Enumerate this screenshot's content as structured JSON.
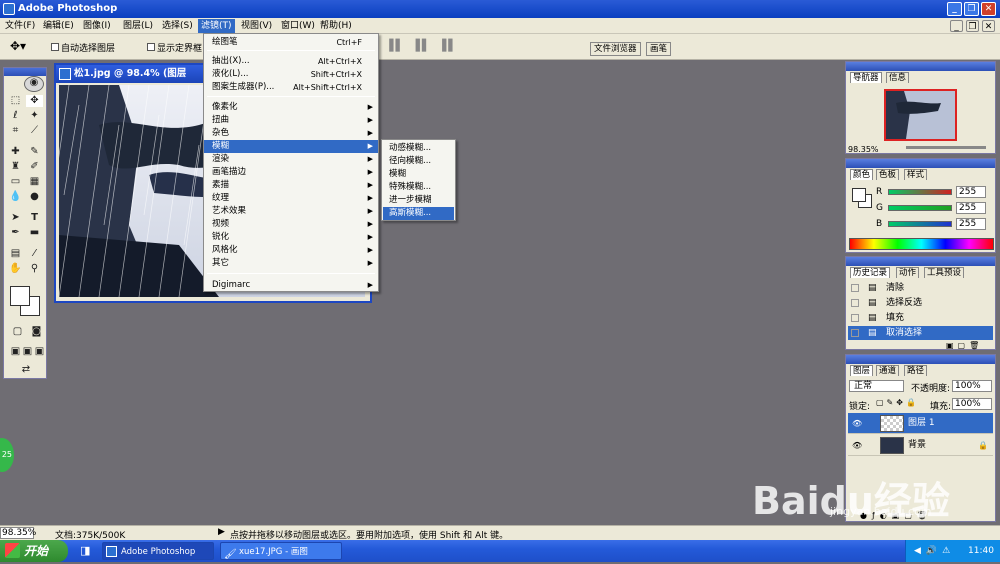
{
  "window": {
    "title": "Adobe Photoshop"
  },
  "menubar": {
    "items": [
      "文件(F)",
      "编辑(E)",
      "图像(I)",
      "图层(L)",
      "选择(S)",
      "滤镜(T)",
      "视图(V)",
      "窗口(W)",
      "帮助(H)"
    ],
    "active_index": 5
  },
  "options": {
    "auto_select": "自动选择图层",
    "show_bounds": "显示定界框",
    "right_tabs": [
      "文件浏览器",
      "画笔"
    ]
  },
  "document": {
    "title": "松1.jpg @ 98.4% (图层"
  },
  "filter_menu": {
    "items": [
      {
        "label": "绘图笔",
        "shortcut": "Ctrl+F",
        "sub": false
      },
      {
        "label": "抽出(X)...",
        "shortcut": "Alt+Ctrl+X",
        "sub": false
      },
      {
        "label": "液化(L)...",
        "shortcut": "Shift+Ctrl+X",
        "sub": false
      },
      {
        "label": "图案生成器(P)...",
        "shortcut": "Alt+Shift+Ctrl+X",
        "sub": false
      },
      {
        "label": "像素化",
        "shortcut": "",
        "sub": true
      },
      {
        "label": "扭曲",
        "shortcut": "",
        "sub": true
      },
      {
        "label": "杂色",
        "shortcut": "",
        "sub": true
      },
      {
        "label": "模糊",
        "shortcut": "",
        "sub": true
      },
      {
        "label": "渲染",
        "shortcut": "",
        "sub": true
      },
      {
        "label": "画笔描边",
        "shortcut": "",
        "sub": true
      },
      {
        "label": "素描",
        "shortcut": "",
        "sub": true
      },
      {
        "label": "纹理",
        "shortcut": "",
        "sub": true
      },
      {
        "label": "艺术效果",
        "shortcut": "",
        "sub": true
      },
      {
        "label": "视频",
        "shortcut": "",
        "sub": true
      },
      {
        "label": "锐化",
        "shortcut": "",
        "sub": true
      },
      {
        "label": "风格化",
        "shortcut": "",
        "sub": true
      },
      {
        "label": "其它",
        "shortcut": "",
        "sub": true
      },
      {
        "label": "Digimarc",
        "shortcut": "",
        "sub": true
      }
    ],
    "selected_index": 7
  },
  "blur_menu": {
    "items": [
      "动感模糊...",
      "径向模糊...",
      "模糊",
      "特殊模糊...",
      "进一步模糊",
      "高斯模糊..."
    ],
    "selected_index": 5
  },
  "navigator": {
    "tabs": [
      "导航器",
      "信息"
    ],
    "zoom": "98.35%"
  },
  "color": {
    "tabs": [
      "颜色",
      "色板",
      "样式"
    ],
    "channels": [
      {
        "label": "R",
        "value": "255",
        "color": "#d02020"
      },
      {
        "label": "G",
        "value": "255",
        "color": "#20a020"
      },
      {
        "label": "B",
        "value": "255",
        "color": "#2030d0"
      }
    ]
  },
  "history": {
    "tabs": [
      "历史记录",
      "动作",
      "工具预设"
    ],
    "items": [
      "清除",
      "选择反选",
      "填充",
      "取消选择"
    ],
    "selected_index": 3
  },
  "layers": {
    "tabs": [
      "图层",
      "通道",
      "路径"
    ],
    "blend_mode": "正常",
    "opacity_label": "不透明度:",
    "opacity": "100%",
    "lock_label": "锁定:",
    "fill_label": "填充:",
    "fill": "100%",
    "items": [
      "图层 1",
      "背景"
    ],
    "selected_index": 0
  },
  "status": {
    "zoom": "98.35%",
    "doc": "文档:375K/500K",
    "hint": "点按并拖移以移动图层或选区。要用附加选项，使用 Shift 和 Alt 键。"
  },
  "taskbar": {
    "start": "开始",
    "tasks": [
      "Adobe Photoshop",
      "xue17.JPG - 画图"
    ],
    "clock": "11:40"
  },
  "watermark": {
    "brand": "Baidu经验",
    "url": "jingyan.baidu.com"
  },
  "badge": {
    "text": "25"
  }
}
